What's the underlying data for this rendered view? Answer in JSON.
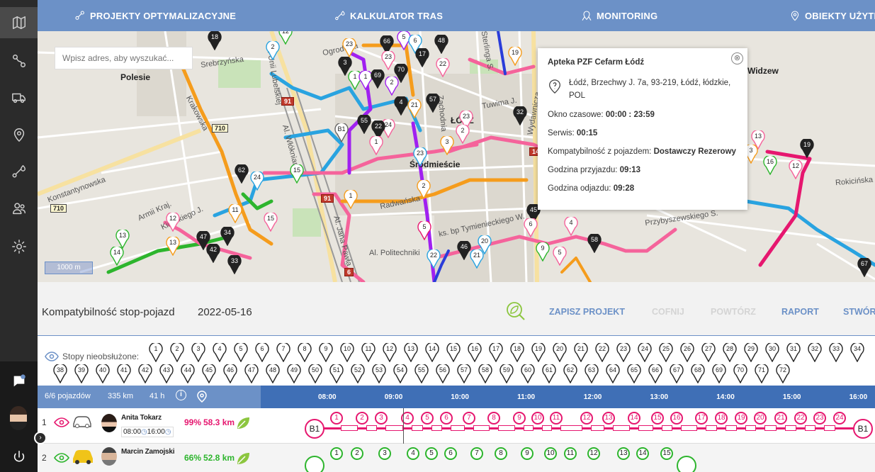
{
  "nav": {
    "items": [
      {
        "label": "PROJEKTY OPTYMALIZACYJNE",
        "icon": "route-pins-icon"
      },
      {
        "label": "KALKULATOR TRAS",
        "icon": "route-calc-icon"
      },
      {
        "label": "MONITORING",
        "icon": "monitoring-pin-icon"
      },
      {
        "label": "OBIEKTY UŻYTK",
        "icon": "location-pin-icon"
      }
    ]
  },
  "sidebar": {
    "items": [
      "map-icon",
      "route-icon",
      "truck-icon",
      "location-pin-icon",
      "route-calc-icon",
      "users-icon",
      "gear-icon"
    ],
    "bottom": [
      "chat-icon",
      "avatar",
      "power-icon"
    ]
  },
  "map": {
    "search_placeholder": "Wpisz adres, aby wyszukać...",
    "scale": "1000 m",
    "labels": {
      "polesie": "Polesie",
      "lodz": "ŁÓDŹ",
      "srodmiescie": "Śródmieście",
      "widzew": "Widzew",
      "srebrzynska": "Srebrzyńska",
      "konstantynowska": "Konstantynowska",
      "krakowska": "Krakowska",
      "armii_krajowej": "Armii Kraj.",
      "ogrodowa": "Ogrodowa",
      "zachodnia": "Zachodnia",
      "wlokniarzy": "Al. Włókniarzy",
      "unii": "Al. Unii Lubelskiej",
      "politechniki": "Al. Politechniki",
      "jana_pawla": "Al. Jana Pawła",
      "radwanska": "Radwańska",
      "tymienieckiego": "ks. bp Tymienieckiego W.",
      "rokicinska": "Rokicińska",
      "przybyszewskiego": "Przybyszewskiego S.",
      "tuwima": "Tuwima J.",
      "kilinskiego": "Kilińskiego J.",
      "wydawnicza": "Wydawnicza",
      "sterlinga": "Sterlinga S."
    },
    "roads": [
      "710",
      "710",
      "91",
      "91",
      "14",
      "6"
    ]
  },
  "popup": {
    "title": "Apteka PZF Cefarm Łódź",
    "address": "Łódź, Brzechwy J. 7a, 93-219, Łódź, łódzkie, POL",
    "window_label": "Okno czasowe:",
    "window_value": "00:00 : 23:59",
    "service_label": "Serwis:",
    "service_value": "00:15",
    "compat_label": "Kompatybilność z pojazdem:",
    "compat_value": "Dostawczy Rezerowy",
    "arrival_label": "Godzina przyjazdu:",
    "arrival_value": "09:13",
    "departure_label": "Godzina odjazdu:",
    "departure_value": "09:28",
    "close": "⊗"
  },
  "toolbar": {
    "title": "Kompatybilność stop-pojazd",
    "date": "2022-05-16",
    "save": "ZAPISZ PROJEKT",
    "undo": "COFNIJ",
    "redo": "POWTÓRZ",
    "report": "RAPORT",
    "create": "STWÓR"
  },
  "unassigned": {
    "label": "Stopy nieobsłużone:",
    "stops": [
      "1",
      "2",
      "3",
      "4",
      "5",
      "6",
      "7",
      "8",
      "9",
      "10",
      "11",
      "12",
      "13",
      "14",
      "15",
      "16",
      "17",
      "18",
      "19",
      "20",
      "21",
      "22",
      "23",
      "24",
      "25",
      "26",
      "27",
      "28",
      "29",
      "30",
      "31",
      "32",
      "33",
      "34",
      "38",
      "39",
      "40",
      "41",
      "42",
      "43",
      "44",
      "45",
      "46",
      "47",
      "48",
      "49",
      "50",
      "51",
      "52",
      "53",
      "54",
      "55",
      "56",
      "57",
      "58",
      "59",
      "60",
      "61",
      "62",
      "63",
      "64",
      "65",
      "66",
      "67",
      "68",
      "69",
      "70",
      "71",
      "72"
    ]
  },
  "timeline": {
    "vehicles": "6/6 pojazdów",
    "distance": "335 km",
    "hours": "41 h",
    "ticks": [
      "08:00",
      "09:00",
      "10:00",
      "11:00",
      "12:00",
      "13:00",
      "14:00",
      "15:00",
      "16:00"
    ],
    "rows": [
      {
        "num": "1",
        "driver": "Anita Tokarz",
        "start": "08:00",
        "end": "16:00",
        "pct": "99%",
        "km": "58.3 km",
        "color": "#e6176f",
        "stops": [
          "1",
          "2",
          "3",
          "4",
          "5",
          "6",
          "7",
          "8",
          "9",
          "10",
          "11",
          "12",
          "13",
          "14",
          "15",
          "16",
          "17",
          "18",
          "19",
          "20",
          "21",
          "22",
          "23",
          "24"
        ],
        "depot": "B1"
      },
      {
        "num": "2",
        "driver": "Marcin Zamojski",
        "pct": "66%",
        "km": "52.8 km",
        "color": "#2db52d",
        "stops": [
          "1",
          "2",
          "3",
          "4",
          "5",
          "6",
          "7",
          "8",
          "9",
          "10",
          "11",
          "12",
          "13",
          "14",
          "15"
        ]
      }
    ]
  },
  "colors": {
    "nav": "#6c91c7",
    "accent_pink": "#e6176f",
    "green": "#2db52d",
    "sidebar": "#2b2b2b"
  }
}
